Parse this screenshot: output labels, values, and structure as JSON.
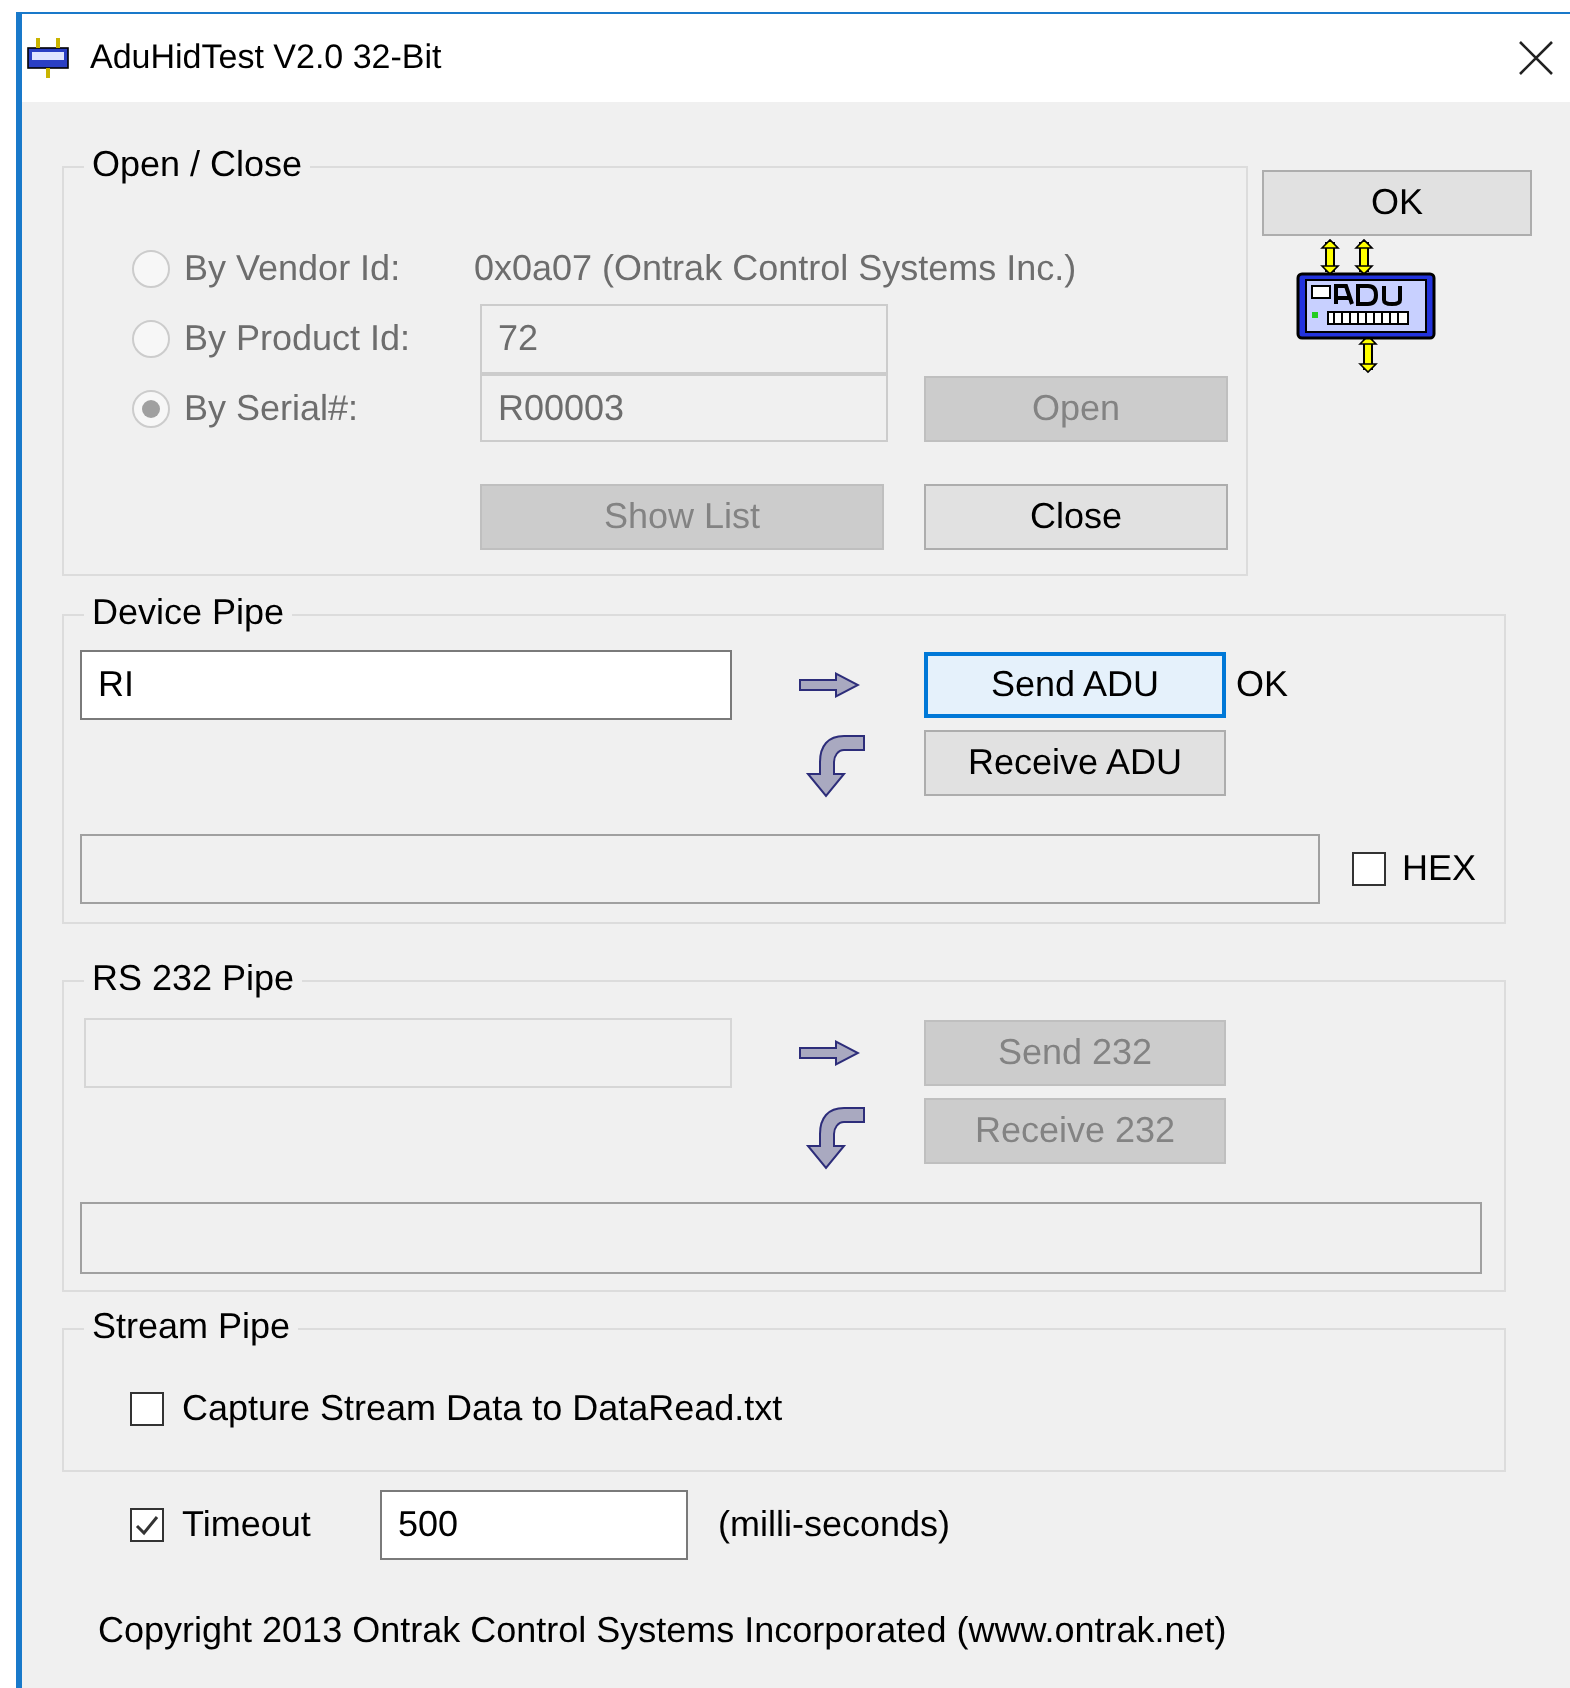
{
  "window": {
    "title": "AduHidTest V2.0 32-Bit"
  },
  "open_close": {
    "title": "Open / Close",
    "disabled": true,
    "options": [
      {
        "label": "By Vendor Id:",
        "selected": false
      },
      {
        "label": "By Product Id:",
        "selected": false
      },
      {
        "label": "By Serial#:",
        "selected": true
      }
    ],
    "vendor_id": "0x0a07 (Ontrak Control Systems Inc.)",
    "product_id": "72",
    "serial": "R00003",
    "open_button": {
      "label": "Open",
      "disabled": true
    },
    "show_list_button": {
      "label": "Show List",
      "disabled": true
    },
    "close_button": {
      "label": "Close",
      "disabled": false
    }
  },
  "ok_button": {
    "label": "OK",
    "disabled": false
  },
  "device_pipe": {
    "title": "Device Pipe",
    "command": "RI",
    "send_button": {
      "label": "Send ADU",
      "disabled": false,
      "focused": true
    },
    "status": "OK",
    "receive_button": {
      "label": "Receive ADU",
      "disabled": false
    },
    "hex": {
      "label": "HEX",
      "checked": false
    }
  },
  "rs232_pipe": {
    "title": "RS 232 Pipe",
    "disabled": true,
    "send_button": {
      "label": "Send 232",
      "disabled": true
    },
    "receive_button": {
      "label": "Receive 232",
      "disabled": true
    }
  },
  "stream_pipe": {
    "title": "Stream Pipe",
    "capture": {
      "label": "Capture Stream Data to DataRead.txt",
      "checked": false
    }
  },
  "timeout": {
    "label": "Timeout",
    "checked": true,
    "value": "500",
    "unit": "(milli-seconds)"
  },
  "copyright": "Copyright 2013 Ontrak Control Systems Incorporated (www.ontrak.net)"
}
